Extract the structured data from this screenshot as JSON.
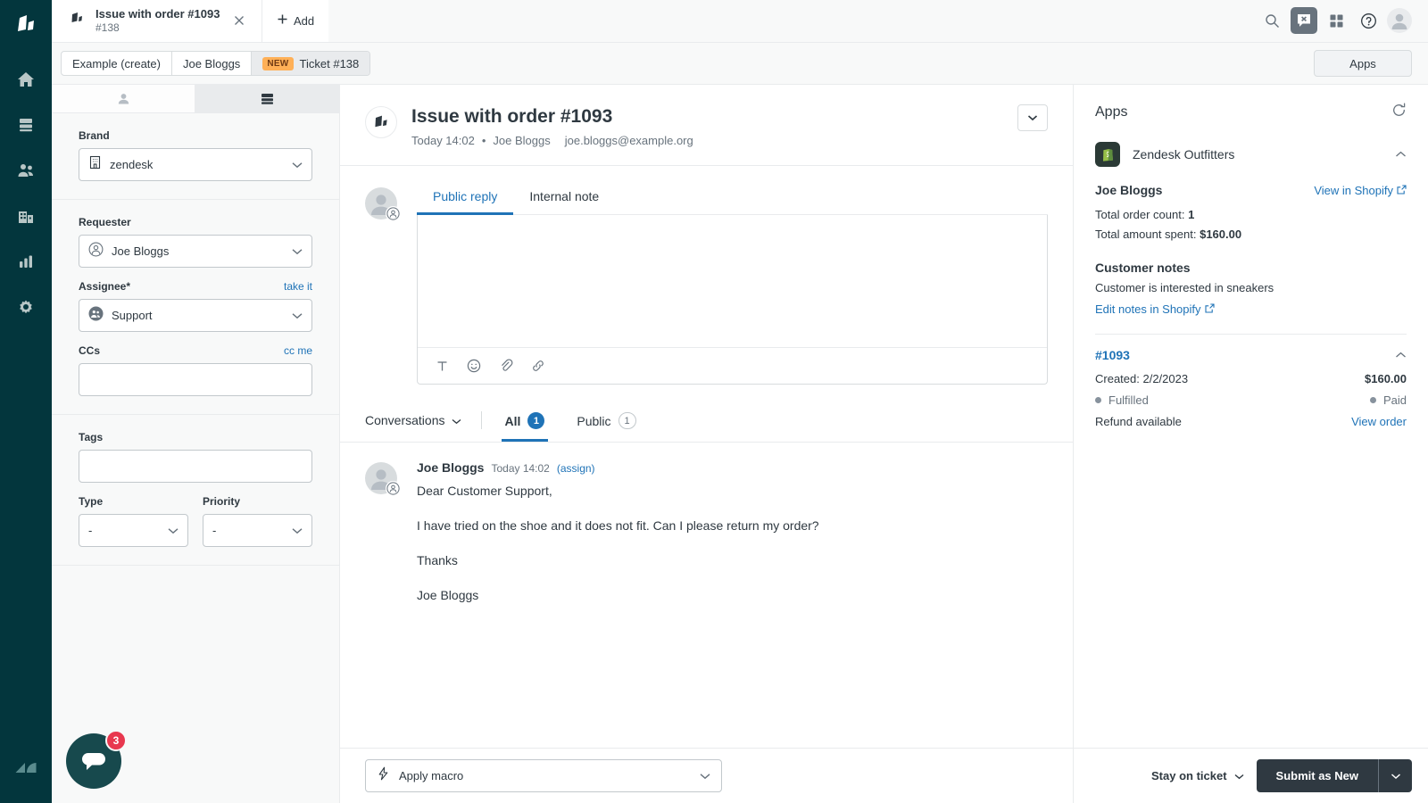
{
  "nav": {
    "logo_icon": "zendesk-product-logo",
    "items": [
      {
        "icon": "home-icon",
        "name": "home"
      },
      {
        "icon": "views-icon",
        "name": "views"
      },
      {
        "icon": "customers-icon",
        "name": "customers"
      },
      {
        "icon": "organizations-icon",
        "name": "organizations"
      },
      {
        "icon": "reporting-icon",
        "name": "reporting"
      },
      {
        "icon": "admin-gear-icon",
        "name": "admin"
      }
    ],
    "footer_logo_icon": "zendesk-logo"
  },
  "topbar": {
    "tab": {
      "icon": "ticket-brand-icon",
      "title": "Issue with order #1093",
      "subtitle": "#138",
      "close_icon": "close-icon"
    },
    "add_label": "Add",
    "add_icon": "plus-icon",
    "actions": [
      {
        "icon": "search-icon",
        "name": "search"
      },
      {
        "icon": "messaging-icon",
        "name": "messaging",
        "active": true
      },
      {
        "icon": "apps-grid-icon",
        "name": "products-grid"
      },
      {
        "icon": "help-icon",
        "name": "help"
      }
    ],
    "avatar_icon": "user-avatar-icon"
  },
  "breadcrumbs": {
    "items": [
      {
        "label": "Example (create)",
        "badge": null
      },
      {
        "label": "Joe Bloggs",
        "badge": null
      },
      {
        "label": "Ticket #138",
        "badge": "NEW"
      }
    ],
    "apps_button": "Apps"
  },
  "properties": {
    "tabs": [
      {
        "icon": "user-icon",
        "name": "user-tab",
        "active": false
      },
      {
        "icon": "ticket-fields-icon",
        "name": "ticket-tab",
        "active": true
      }
    ],
    "brand": {
      "label": "Brand",
      "value": "zendesk",
      "icon": "brand-building-icon"
    },
    "requester": {
      "label": "Requester",
      "value": "Joe Bloggs",
      "icon": "requester-avatar-icon"
    },
    "assignee": {
      "label": "Assignee*",
      "value": "Support",
      "action_link": "take it",
      "icon": "group-avatar-icon"
    },
    "ccs": {
      "label": "CCs",
      "value": "",
      "action_link": "cc me"
    },
    "tags": {
      "label": "Tags",
      "value": ""
    },
    "type": {
      "label": "Type",
      "value": "-"
    },
    "priority": {
      "label": "Priority",
      "value": "-"
    },
    "messenger": {
      "icon": "messenger-bubble-icon",
      "unread_count": "3"
    }
  },
  "ticket": {
    "brand_icon": "ticket-brand-icon",
    "title": "Issue with order #1093",
    "time": "Today 14:02",
    "separator": "•",
    "author": "Joe Bloggs",
    "email": "joe.bloggs@example.org",
    "collapse_icon": "chevron-down-icon"
  },
  "composer": {
    "avatar_icon": "user-avatar-icon",
    "avatar_badge_icon": "end-user-badge-icon",
    "tabs": [
      {
        "label": "Public reply",
        "active": true
      },
      {
        "label": "Internal note",
        "active": false
      }
    ],
    "editor_value": "",
    "toolbar": [
      {
        "icon": "text-format-icon",
        "name": "text-format"
      },
      {
        "icon": "emoji-icon",
        "name": "emoji"
      },
      {
        "icon": "attachment-icon",
        "name": "attachment"
      },
      {
        "icon": "link-icon",
        "name": "link"
      }
    ]
  },
  "conversations": {
    "dropdown_label": "Conversations",
    "dropdown_icon": "chevron-down-icon",
    "filters": [
      {
        "label": "All",
        "count": "1",
        "active": true,
        "badge_style": "filled"
      },
      {
        "label": "Public",
        "count": "1",
        "active": false,
        "badge_style": "outline"
      }
    ]
  },
  "comments": [
    {
      "avatar_icon": "user-avatar-icon",
      "avatar_badge_icon": "end-user-badge-icon",
      "author": "Joe Bloggs",
      "time": "Today 14:02",
      "assign_link": "(assign)",
      "paragraphs": [
        "Dear Customer Support,",
        "I have tried on the shoe and it does not fit. Can I please return my order?",
        "Thanks",
        "Joe Bloggs"
      ]
    }
  ],
  "footer": {
    "macro_label": "Apply macro",
    "macro_icon": "lightning-bolt-icon",
    "macro_chevron_icon": "chevron-down-icon",
    "stay_label": "Stay on ticket",
    "stay_icon": "chevron-down-icon",
    "submit_label": "Submit as New",
    "submit_chevron_icon": "chevron-down-icon"
  },
  "apps_panel": {
    "title": "Apps",
    "refresh_icon": "refresh-icon",
    "app": {
      "icon": "shopify-icon",
      "name": "Zendesk Outfitters",
      "collapse_icon": "chevron-up-icon",
      "customer_name": "Joe Bloggs",
      "view_link": "View in Shopify",
      "view_link_icon": "external-link-icon",
      "stats": [
        {
          "label": "Total order count:",
          "value": "1"
        },
        {
          "label": "Total amount spent:",
          "value": "$160.00"
        }
      ],
      "notes_title": "Customer notes",
      "notes_text": "Customer is interested in sneakers",
      "notes_link": "Edit notes in Shopify",
      "notes_link_icon": "external-link-icon",
      "order": {
        "id": "#1093",
        "collapse_icon": "chevron-up-icon",
        "created_label": "Created: 2/2/2023",
        "amount": "$160.00",
        "fulfillment_status": "Fulfilled",
        "payment_status": "Paid",
        "refund_label": "Refund available",
        "view_order_link": "View order"
      }
    }
  },
  "colors": {
    "nav_bg": "#03363d",
    "accent_blue": "#1f73b7",
    "badge_new": "#ffb057",
    "submit_dark": "#2f3941",
    "messenger_badge": "#e8384f"
  }
}
